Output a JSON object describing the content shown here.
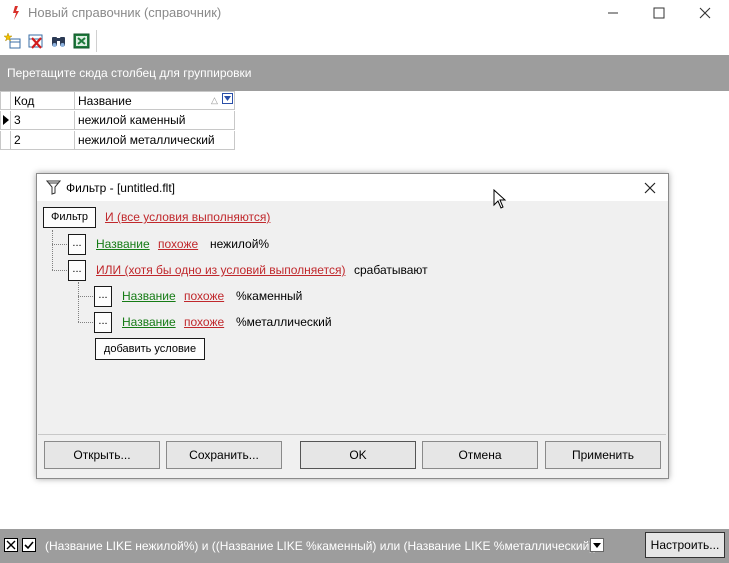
{
  "window": {
    "title": "Новый справочник  (справочник)",
    "minimize_glyph": "—",
    "maximize_glyph": "☐",
    "close_glyph": "✕"
  },
  "toolbar": {
    "icons": [
      "add-record-icon",
      "delete-record-icon",
      "find-icon",
      "excel-export-icon"
    ]
  },
  "group_panel": {
    "hint": "Перетащите сюда столбец для группировки"
  },
  "grid": {
    "columns": [
      "Код",
      "Название"
    ],
    "rows": [
      {
        "code": "3",
        "name": "нежилой каменный",
        "current": true
      },
      {
        "code": "2",
        "name": "нежилой металлический",
        "current": false
      }
    ]
  },
  "dialog": {
    "title": "Фильтр - [untitled.flt]",
    "root_button": "Фильтр",
    "root_condition": "И (все условия выполняются)",
    "node_button": "...",
    "conditions": [
      {
        "field": "Название",
        "operator": "похоже",
        "value": "нежилой%"
      }
    ],
    "or_group": {
      "label": "ИЛИ (хотя бы одно из условий выполняется)",
      "suffix": "срабатывают",
      "conditions": [
        {
          "field": "Название",
          "operator": "похоже",
          "value": "%каменный"
        },
        {
          "field": "Название",
          "operator": "похоже",
          "value": "%металлический"
        }
      ]
    },
    "add_condition": "добавить условие",
    "buttons": {
      "open": "Открыть...",
      "save": "Сохранить...",
      "ok": "OK",
      "cancel": "Отмена",
      "apply": "Применить"
    }
  },
  "statusbar": {
    "filter_text": "(Название LIKE нежилой%) и ((Название LIKE %каменный) или (Название LIKE %металлический))",
    "configure": "Настроить...",
    "clear_glyph": "✕",
    "enable_glyph": "✔"
  },
  "colors": {
    "panel_gray": "#9d9d9d",
    "field_green": "#157b15",
    "operator_red": "#c0282c",
    "value_blue": "#2424c8"
  }
}
